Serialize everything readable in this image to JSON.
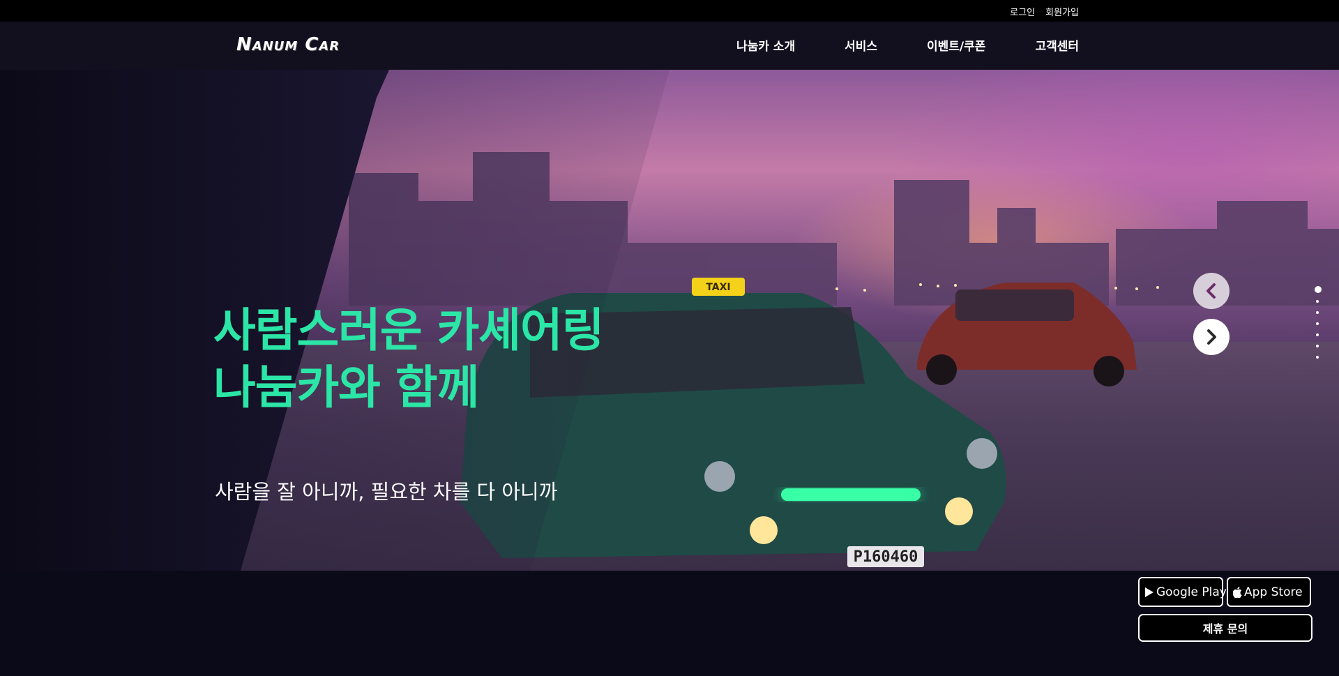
{
  "util": {
    "login": "로그인",
    "signup": "회원가입"
  },
  "nav": {
    "logo": "Nanum Car",
    "items": [
      "나눔카 소개",
      "서비스",
      "이벤트/쿠폰",
      "고객센터"
    ]
  },
  "hero": {
    "headline_line1": "사람스러운 카셰어링",
    "headline_line2": "나눔카와 함께",
    "subline": "사람을 잘 아니까, 필요한 차를 다 아니까",
    "taxi_sign": "TAXI",
    "plate": "P160460",
    "slider_dots": 7,
    "active_dot": 1
  },
  "apps": {
    "google": "Google Play",
    "apple": "App Store",
    "partner": "제휴 문의"
  },
  "colors": {
    "accent": "#2be6a6",
    "nav_bg": "#12101f",
    "page_bg": "#0b0a18"
  }
}
